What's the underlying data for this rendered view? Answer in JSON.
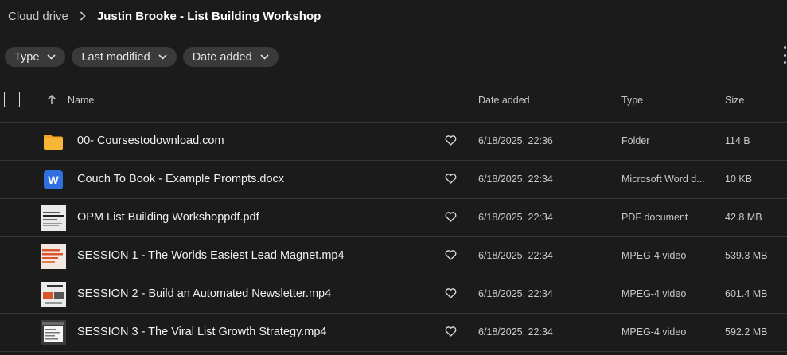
{
  "breadcrumb": {
    "root": "Cloud drive",
    "current": "Justin Brooke - List Building Workshop"
  },
  "filters": [
    {
      "label": "Type",
      "icon": "chevron-down-icon"
    },
    {
      "label": "Last modified",
      "icon": "chevron-down-icon"
    },
    {
      "label": "Date added",
      "icon": "chevron-down-icon"
    }
  ],
  "columns": {
    "name": "Name",
    "date_added": "Date added",
    "type": "Type",
    "size": "Size"
  },
  "files": [
    {
      "name": "00- Coursestodownload.com",
      "date": "6/18/2025, 22:36",
      "type": "Folder",
      "size": "114 B",
      "icon": "folder-icon"
    },
    {
      "name": "Couch To Book - Example Prompts.docx",
      "date": "6/18/2025, 22:34",
      "type": "Microsoft Word d...",
      "size": "10 KB",
      "icon": "word-doc-icon",
      "icon_letter": "W"
    },
    {
      "name": "OPM List Building Workshoppdf.pdf",
      "date": "6/18/2025, 22:34",
      "type": "PDF document",
      "size": "42.8 MB",
      "icon": "pdf-thumbnail"
    },
    {
      "name": "SESSION 1 - The Worlds Easiest Lead Magnet.mp4",
      "date": "6/18/2025, 22:34",
      "type": "MPEG-4 video",
      "size": "539.3 MB",
      "icon": "video-thumbnail"
    },
    {
      "name": "SESSION 2 - Build an Automated Newsletter.mp4",
      "date": "6/18/2025, 22:34",
      "type": "MPEG-4 video",
      "size": "601.4 MB",
      "icon": "video-thumbnail"
    },
    {
      "name": "SESSION 3 - The Viral List Growth Strategy.mp4",
      "date": "6/18/2025, 22:34",
      "type": "MPEG-4 video",
      "size": "592.2 MB",
      "icon": "video-thumbnail"
    }
  ],
  "colors": {
    "background": "#1b1b1b",
    "chip": "#3a3a3a",
    "divider": "#353535",
    "folder": "#f5a623",
    "word": "#2f6fe0"
  }
}
